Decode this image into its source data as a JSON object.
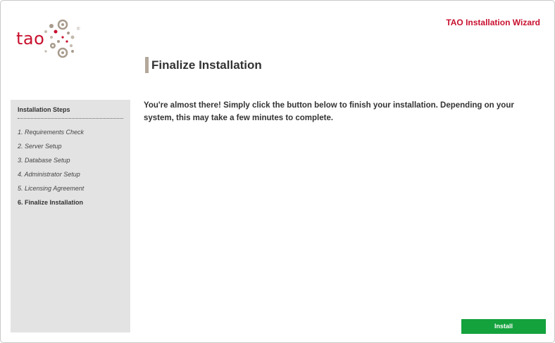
{
  "header": {
    "logo_text": "tao",
    "logo_mark": "®",
    "wizard_title": "TAO Installation Wizard"
  },
  "page": {
    "title": "Finalize Installation",
    "intro": "You're almost there! Simply click the button below to finish your installation. Depending on your system, this may take a few minutes to complete."
  },
  "sidebar": {
    "heading": "Installation Steps",
    "steps": [
      {
        "label": "1. Requirements Check"
      },
      {
        "label": "2. Server Setup"
      },
      {
        "label": "3. Database Setup"
      },
      {
        "label": "4. Administrator Setup"
      },
      {
        "label": "5. Licensing Agreement"
      },
      {
        "label": "6. Finalize Installation"
      }
    ],
    "active_step": 6
  },
  "actions": {
    "install_label": "Install"
  },
  "colors": {
    "brand_red": "#c8102e",
    "sidebar_bg": "#e3e3e3",
    "install_green": "#14a23d",
    "title_bar": "#b3a89b"
  }
}
